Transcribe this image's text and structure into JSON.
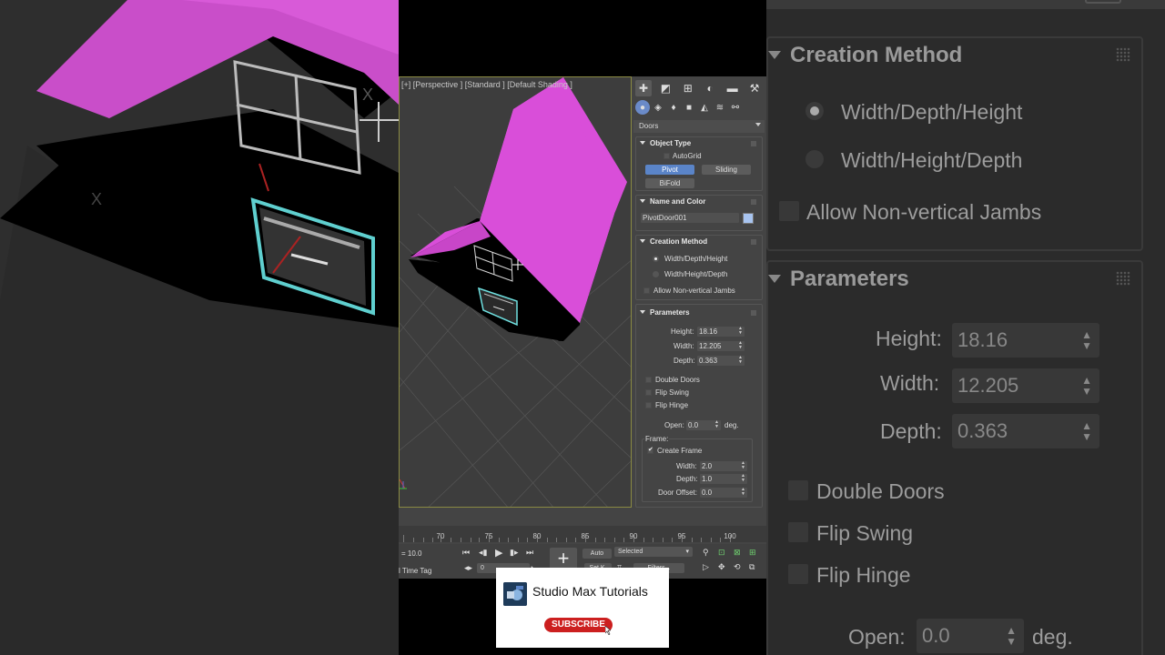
{
  "viewport": {
    "label": "[+] [Perspective ] [Standard ] [Default Shading ]"
  },
  "command_panel": {
    "category": "Doors",
    "object_type": {
      "title": "Object Type",
      "autogrid": "AutoGrid",
      "buttons": [
        "Pivot",
        "Sliding",
        "BiFold"
      ],
      "active": "Pivot"
    },
    "name_and_color": {
      "title": "Name and Color",
      "name": "PivotDoor001",
      "color": "#a8c4f0"
    },
    "creation_method": {
      "title": "Creation Method",
      "options": [
        "Width/Depth/Height",
        "Width/Height/Depth"
      ],
      "selected": "Width/Depth/Height",
      "allow_jambs": "Allow Non-vertical Jambs"
    },
    "parameters": {
      "title": "Parameters",
      "height_label": "Height:",
      "height": "18.16",
      "width_label": "Width:",
      "width": "12.205",
      "depth_label": "Depth:",
      "depth": "0.363",
      "double_doors": "Double Doors",
      "flip_swing": "Flip Swing",
      "flip_hinge": "Flip Hinge",
      "open_label": "Open:",
      "open": "0.0",
      "deg": "deg.",
      "frame_label": "Frame:",
      "create_frame": "Create Frame",
      "frame_width_label": "Width:",
      "frame_width": "2.0",
      "frame_depth_label": "Depth:",
      "frame_depth": "1.0",
      "door_offset_label": "Door Offset:",
      "door_offset": "0.0"
    }
  },
  "timeline": {
    "ticks": [
      "70",
      "75",
      "80",
      "85",
      "90",
      "95",
      "100"
    ]
  },
  "bottom_bar": {
    "coord_value": "= 10.0",
    "time_tag": "l Time Tag",
    "frame_field": "0",
    "auto_label": "Auto",
    "selected_label": "Selected",
    "set_key": "Set K.",
    "filters": "Filters..."
  },
  "subscribe_card": {
    "channel": "Studio Max Tutorials",
    "button": "SUBSCRIBE"
  },
  "colors": {
    "roof": "#d94ed9",
    "door_outline": "#6fe0e0",
    "ui_active": "#5a84c8",
    "subscribe_red": "#cc1f1f"
  }
}
